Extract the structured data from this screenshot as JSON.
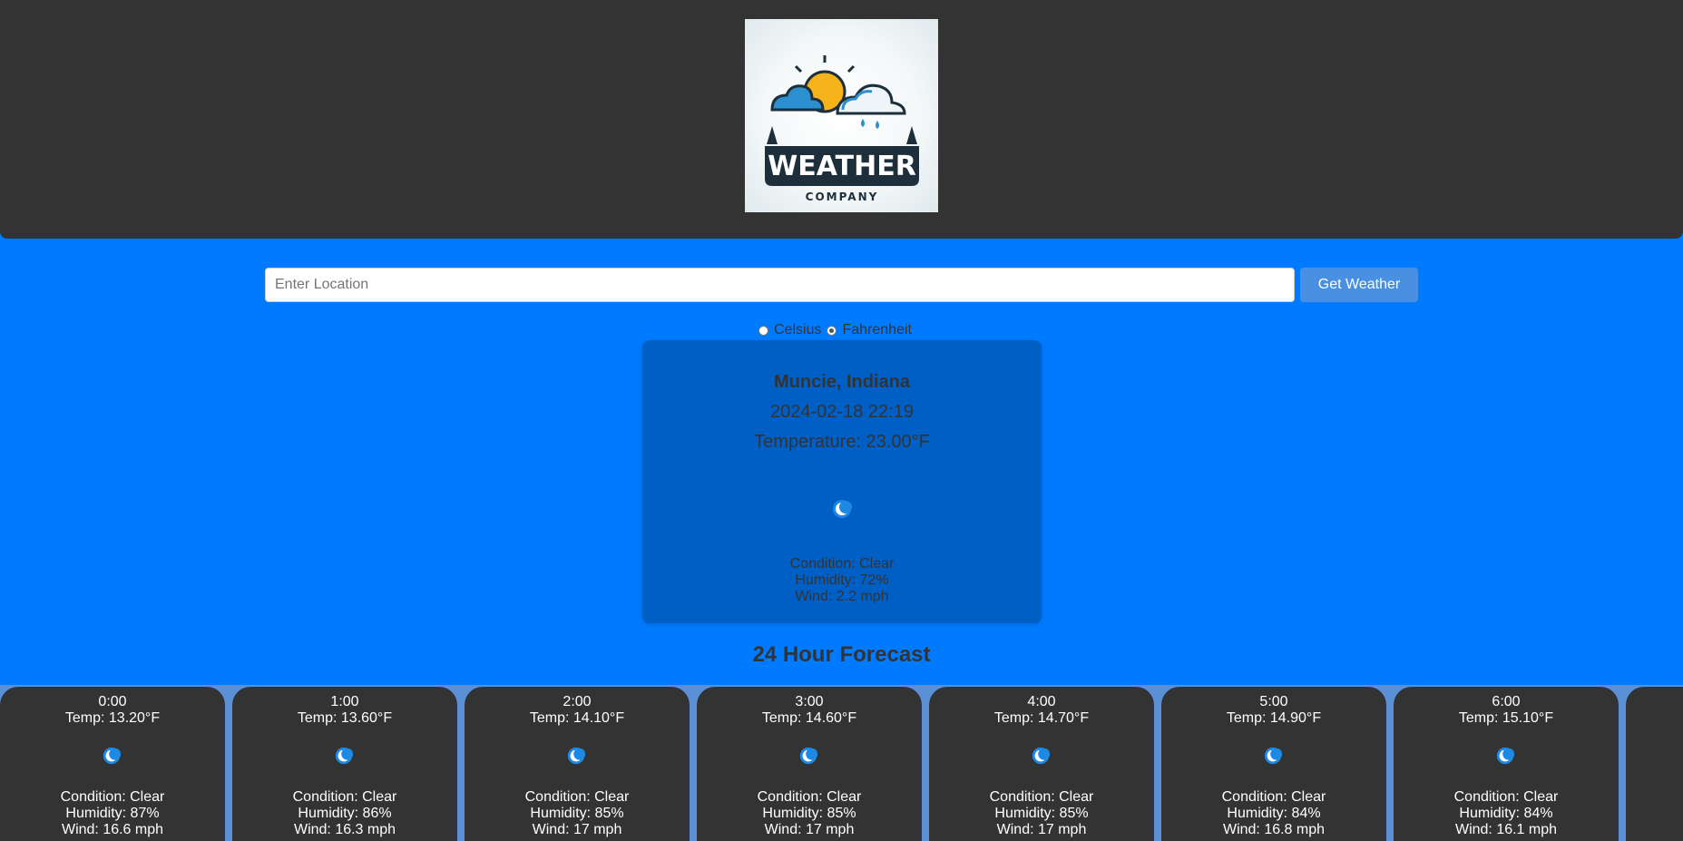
{
  "header": {
    "logo": {
      "brand_word": "WEATHER",
      "brand_sub": "COMPANY",
      "icon": "weather-logo-icon"
    }
  },
  "search": {
    "placeholder": "Enter Location",
    "value": "",
    "button_label": "Get Weather"
  },
  "units": {
    "celsius_label": "Celsius",
    "fahrenheit_label": "Fahrenheit",
    "selected": "Fahrenheit"
  },
  "current": {
    "location": "Muncie, Indiana",
    "datetime": "2024-02-18 22:19",
    "temperature": "Temperature: 23.00°F",
    "icon": "moon-icon",
    "condition": "Condition: Clear",
    "humidity": "Humidity: 72%",
    "wind": "Wind: 2.2 mph"
  },
  "forecast": {
    "title": "24 Hour Forecast",
    "hours": [
      {
        "time": "0:00",
        "temp": "Temp: 13.20°F",
        "icon": "moon-icon",
        "condition": "Condition: Clear",
        "humidity": "Humidity: 87%",
        "wind": "Wind: 16.6 mph"
      },
      {
        "time": "1:00",
        "temp": "Temp: 13.60°F",
        "icon": "moon-icon",
        "condition": "Condition: Clear",
        "humidity": "Humidity: 86%",
        "wind": "Wind: 16.3 mph"
      },
      {
        "time": "2:00",
        "temp": "Temp: 14.10°F",
        "icon": "moon-icon",
        "condition": "Condition: Clear",
        "humidity": "Humidity: 85%",
        "wind": "Wind: 17 mph"
      },
      {
        "time": "3:00",
        "temp": "Temp: 14.60°F",
        "icon": "moon-icon",
        "condition": "Condition: Clear",
        "humidity": "Humidity: 85%",
        "wind": "Wind: 17 mph"
      },
      {
        "time": "4:00",
        "temp": "Temp: 14.70°F",
        "icon": "moon-icon",
        "condition": "Condition: Clear",
        "humidity": "Humidity: 85%",
        "wind": "Wind: 17 mph"
      },
      {
        "time": "5:00",
        "temp": "Temp: 14.90°F",
        "icon": "moon-icon",
        "condition": "Condition: Clear",
        "humidity": "Humidity: 84%",
        "wind": "Wind: 16.8 mph"
      },
      {
        "time": "6:00",
        "temp": "Temp: 15.10°F",
        "icon": "moon-icon",
        "condition": "Condition: Clear",
        "humidity": "Humidity: 84%",
        "wind": "Wind: 16.1 mph"
      }
    ]
  },
  "colors": {
    "page_bg": "#007bff",
    "header_bg": "#333333",
    "card_bg": "#005fc4",
    "forecast_card_bg": "#333333",
    "button_bg": "#4a90e2",
    "moon_blue": "#1e88e5"
  }
}
